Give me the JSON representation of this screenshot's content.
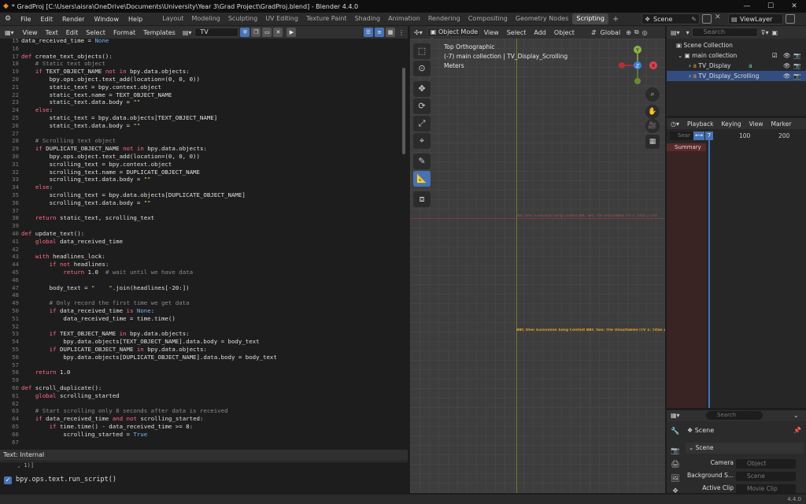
{
  "window": {
    "title": "* GradProj [C:\\Users\\aisra\\OneDrive\\Documents\\University\\Year 3\\Grad Project\\GradProj.blend] - Blender 4.4.0"
  },
  "menu": [
    "File",
    "Edit",
    "Render",
    "Window",
    "Help"
  ],
  "workspaces": [
    "Layout",
    "Modeling",
    "Sculpting",
    "UV Editing",
    "Texture Paint",
    "Shading",
    "Animation",
    "Rendering",
    "Compositing",
    "Geometry Nodes",
    "Scripting"
  ],
  "active_workspace": "Scripting",
  "scene_name": "Scene",
  "view_layer": "ViewLayer",
  "text_editor": {
    "menu": [
      "View",
      "Text",
      "Edit",
      "Select",
      "Format",
      "Templates"
    ],
    "text_name": "TV",
    "footer": "Text: Internal"
  },
  "code_lines": [
    {
      "n": "15",
      "t": "data_received_time = None"
    },
    {
      "n": "16",
      "t": ""
    },
    {
      "n": "17",
      "t": "def create_text_objects():"
    },
    {
      "n": "18",
      "t": "    # Static text object"
    },
    {
      "n": "19",
      "t": "    if TEXT_OBJECT_NAME not in bpy.data.objects:"
    },
    {
      "n": "20",
      "t": "        bpy.ops.object.text_add(location=(0, 0, 0))"
    },
    {
      "n": "21",
      "t": "        static_text = bpy.context.object"
    },
    {
      "n": "22",
      "t": "        static_text.name = TEXT_OBJECT_NAME"
    },
    {
      "n": "23",
      "t": "        static_text.data.body = \"\""
    },
    {
      "n": "24",
      "t": "    else:"
    },
    {
      "n": "25",
      "t": "        static_text = bpy.data.objects[TEXT_OBJECT_NAME]"
    },
    {
      "n": "26",
      "t": "        static_text.data.body = \"\""
    },
    {
      "n": "27",
      "t": ""
    },
    {
      "n": "28",
      "t": "    # Scrolling text object"
    },
    {
      "n": "29",
      "t": "    if DUPLICATE_OBJECT_NAME not in bpy.data.objects:"
    },
    {
      "n": "30",
      "t": "        bpy.ops.object.text_add(location=(0, 0, 0))"
    },
    {
      "n": "31",
      "t": "        scrolling_text = bpy.context.object"
    },
    {
      "n": "32",
      "t": "        scrolling_text.name = DUPLICATE_OBJECT_NAME"
    },
    {
      "n": "33",
      "t": "        scrolling_text.data.body = \"\""
    },
    {
      "n": "34",
      "t": "    else:"
    },
    {
      "n": "35",
      "t": "        scrolling_text = bpy.data.objects[DUPLICATE_OBJECT_NAME]"
    },
    {
      "n": "36",
      "t": "        scrolling_text.data.body = \"\""
    },
    {
      "n": "37",
      "t": ""
    },
    {
      "n": "38",
      "t": "    return static_text, scrolling_text"
    },
    {
      "n": "39",
      "t": ""
    },
    {
      "n": "40",
      "t": "def update_text():"
    },
    {
      "n": "41",
      "t": "    global data_received_time"
    },
    {
      "n": "42",
      "t": ""
    },
    {
      "n": "43",
      "t": "    with headlines_lock:"
    },
    {
      "n": "44",
      "t": "        if not headlines:"
    },
    {
      "n": "45",
      "t": "            return 1.0  # wait until we have data"
    },
    {
      "n": "46",
      "t": ""
    },
    {
      "n": "47",
      "t": "        body_text = \"    \".join(headlines[-20:])"
    },
    {
      "n": "48",
      "t": ""
    },
    {
      "n": "49",
      "t": "        # Only record the first time we get data"
    },
    {
      "n": "50",
      "t": "        if data_received_time is None:"
    },
    {
      "n": "51",
      "t": "            data_received_time = time.time()"
    },
    {
      "n": "52",
      "t": ""
    },
    {
      "n": "53",
      "t": "        if TEXT_OBJECT_NAME in bpy.data.objects:"
    },
    {
      "n": "54",
      "t": "            bpy.data.objects[TEXT_OBJECT_NAME].data.body = body_text"
    },
    {
      "n": "55",
      "t": "        if DUPLICATE_OBJECT_NAME in bpy.data.objects:"
    },
    {
      "n": "56",
      "t": "            bpy.data.objects[DUPLICATE_OBJECT_NAME].data.body = body_text"
    },
    {
      "n": "57",
      "t": ""
    },
    {
      "n": "58",
      "t": "    return 1.0"
    },
    {
      "n": "59",
      "t": ""
    },
    {
      "n": "60",
      "t": "def scroll_duplicate():"
    },
    {
      "n": "61",
      "t": "    global scrolling_started"
    },
    {
      "n": "62",
      "t": ""
    },
    {
      "n": "63",
      "t": "    # Start scrolling only 8 seconds after data is received"
    },
    {
      "n": "64",
      "t": "    if data_received_time and not scrolling_started:"
    },
    {
      "n": "65",
      "t": "        if time.time() - data_received_time >= 8:"
    },
    {
      "n": "66",
      "t": "            scrolling_started = True"
    },
    {
      "n": "67",
      "t": ""
    }
  ],
  "console": {
    "prev": ", 1)]",
    "command": "bpy.ops.text.run_script()"
  },
  "viewport": {
    "mode": "Object Mode",
    "menu": [
      "View",
      "Select",
      "Add",
      "Object"
    ],
    "orientation": "Global",
    "view_name": "Top Orthographic",
    "collection_info": "(-7) main collection | TV_Display_Scrolling",
    "units": "Meters",
    "ticker_red": "BBC One: Eurovision Song Contest   BBC Two: The Unsuitables   ITV 1: Titan 2   Cha",
    "ticker_orange": "BBC One: Eurovision Song Contest   BBC Two: The Unsuitables   ITV 1: Titan 2   Cha",
    "gizmo": {
      "y": "Y",
      "z": "Z",
      "x": "X"
    }
  },
  "outliner": {
    "search_placeholder": "Search",
    "scene_collection": "Scene Collection",
    "main_collection": "main collection",
    "items": [
      "TV_Display",
      "TV_Display_Scrolling"
    ]
  },
  "timeline": {
    "menu": [
      "Playback",
      "Keying",
      "View",
      "Marker"
    ],
    "current_frame": "7",
    "search_placeholder": "Sear",
    "ticks": [
      "100",
      "200"
    ],
    "summary": "Summary"
  },
  "properties": {
    "search_placeholder": "Search",
    "scene_title": "Scene",
    "panel": "Scene",
    "camera_label": "Camera",
    "camera_value": "Object",
    "background_label": "Background S...",
    "background_value": "Scene",
    "active_clip_label": "Active Clip",
    "active_clip_value": "Movie Clip"
  },
  "status": {
    "version": "4.4.0"
  },
  "colors": {
    "accent": "#4772b3",
    "keyword": "#ff6b8a",
    "ticker_orange": "#e8a030",
    "ticker_red": "#b05060"
  }
}
